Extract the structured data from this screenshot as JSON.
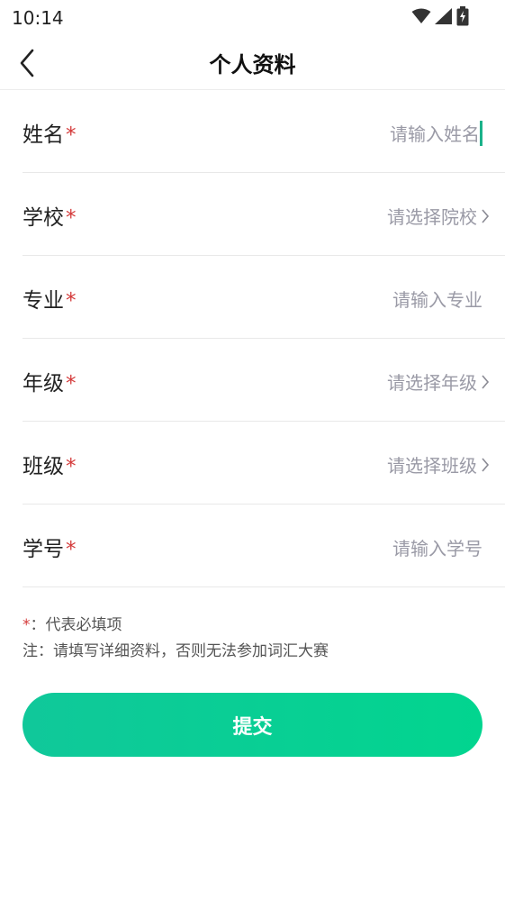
{
  "status_bar": {
    "time": "10:14",
    "icons": [
      "wifi-icon",
      "signal-icon",
      "battery-charging-icon"
    ]
  },
  "header": {
    "title": "个人资料",
    "back_icon": "chevron-left-icon"
  },
  "form": {
    "required_mark": "*",
    "rows": [
      {
        "label": "姓名",
        "placeholder": "请输入姓名",
        "type": "input",
        "focused": true
      },
      {
        "label": "学校",
        "placeholder": "请选择院校",
        "type": "select"
      },
      {
        "label": "专业",
        "placeholder": "请输入专业",
        "type": "input"
      },
      {
        "label": "年级",
        "placeholder": "请选择年级",
        "type": "select"
      },
      {
        "label": "班级",
        "placeholder": "请选择班级",
        "type": "select"
      },
      {
        "label": "学号",
        "placeholder": "请输入学号",
        "type": "input"
      }
    ]
  },
  "notes": {
    "star": "*",
    "required_hint": "：代表必填项",
    "detail_hint": "注：请填写详细资料，否则无法参加词汇大赛"
  },
  "submit": {
    "label": "提交"
  },
  "colors": {
    "accent_start": "#10c89a",
    "accent_end": "#02d58f",
    "required": "#d43a3a",
    "placeholder": "#9a9aa6",
    "cursor": "#1bb28a"
  }
}
